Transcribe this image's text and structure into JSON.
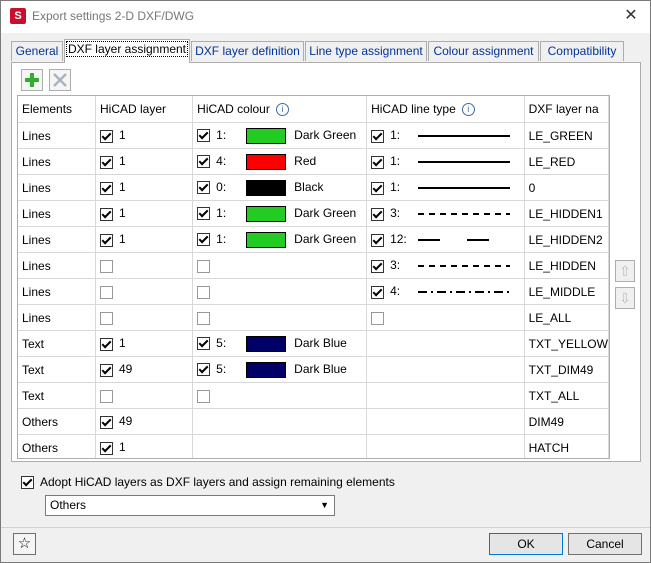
{
  "window": {
    "title": "Export settings 2-D DXF/DWG",
    "app_icon": "S",
    "close_glyph": "✕"
  },
  "tabs": [
    {
      "label": "General"
    },
    {
      "label": "DXF layer assignment",
      "active": true
    },
    {
      "label": "DXF layer definition"
    },
    {
      "label": "Line type assignment"
    },
    {
      "label": "Colour assignment"
    },
    {
      "label": "Compatibility"
    }
  ],
  "toolbar": {
    "add_icon": "add-icon",
    "delete_icon": "delete-icon"
  },
  "table": {
    "headers": [
      "Elements",
      "HiCAD layer",
      "HiCAD colour",
      "HiCAD line type",
      "DXF layer na"
    ],
    "rows": [
      {
        "element": "Lines",
        "layer_checked": true,
        "layer": "1",
        "colour_checked": true,
        "colour_num": "1:",
        "swatch": "#22cc22",
        "colour_name": "Dark Green",
        "lt_checked": true,
        "lt_num": "1:",
        "lt_style": "solid",
        "dxf": "LE_GREEN"
      },
      {
        "element": "Lines",
        "layer_checked": true,
        "layer": "1",
        "colour_checked": true,
        "colour_num": "4:",
        "swatch": "#ff0000",
        "colour_name": "Red",
        "lt_checked": true,
        "lt_num": "1:",
        "lt_style": "solid",
        "dxf": "LE_RED"
      },
      {
        "element": "Lines",
        "layer_checked": true,
        "layer": "1",
        "colour_checked": true,
        "colour_num": "0:",
        "swatch": "#000000",
        "colour_name": "Black",
        "lt_checked": true,
        "lt_num": "1:",
        "lt_style": "solid",
        "dxf": "0"
      },
      {
        "element": "Lines",
        "layer_checked": true,
        "layer": "1",
        "colour_checked": true,
        "colour_num": "1:",
        "swatch": "#22cc22",
        "colour_name": "Dark Green",
        "lt_checked": true,
        "lt_num": "3:",
        "lt_style": "dashed",
        "dxf": "LE_HIDDEN1"
      },
      {
        "element": "Lines",
        "layer_checked": true,
        "layer": "1",
        "colour_checked": true,
        "colour_num": "1:",
        "swatch": "#22cc22",
        "colour_name": "Dark Green",
        "lt_checked": true,
        "lt_num": "12:",
        "lt_style": "longdash",
        "dxf": "LE_HIDDEN2"
      },
      {
        "element": "Lines",
        "layer_checked": false,
        "layer": "",
        "colour_checked": false,
        "colour_num": "",
        "swatch": "",
        "colour_name": "",
        "lt_checked": true,
        "lt_num": "3:",
        "lt_style": "dashed",
        "dxf": "LE_HIDDEN"
      },
      {
        "element": "Lines",
        "layer_checked": false,
        "layer": "",
        "colour_checked": false,
        "colour_num": "",
        "swatch": "",
        "colour_name": "",
        "lt_checked": true,
        "lt_num": "4:",
        "lt_style": "dashdot",
        "dxf": "LE_MIDDLE"
      },
      {
        "element": "Lines",
        "layer_checked": false,
        "layer": "",
        "colour_checked": false,
        "colour_num": "",
        "swatch": "",
        "colour_name": "",
        "lt_checked": false,
        "lt_num": "",
        "lt_style": "",
        "dxf": "LE_ALL"
      },
      {
        "element": "Text",
        "layer_checked": true,
        "layer": "1",
        "colour_checked": true,
        "colour_num": "5:",
        "swatch": "#000066",
        "colour_name": "Dark Blue",
        "lt_checked": null,
        "lt_num": "",
        "lt_style": "",
        "dxf": "TXT_YELLOW"
      },
      {
        "element": "Text",
        "layer_checked": true,
        "layer": "49",
        "colour_checked": true,
        "colour_num": "5:",
        "swatch": "#000066",
        "colour_name": "Dark Blue",
        "lt_checked": null,
        "lt_num": "",
        "lt_style": "",
        "dxf": "TXT_DIM49"
      },
      {
        "element": "Text",
        "layer_checked": false,
        "layer": "",
        "colour_checked": false,
        "colour_num": "",
        "swatch": "",
        "colour_name": "",
        "lt_checked": null,
        "lt_num": "",
        "lt_style": "",
        "dxf": "TXT_ALL"
      },
      {
        "element": "Others",
        "layer_checked": true,
        "layer": "49",
        "colour_checked": null,
        "colour_num": "",
        "swatch": "",
        "colour_name": "",
        "lt_checked": null,
        "lt_num": "",
        "lt_style": "",
        "dxf": "DIM49"
      },
      {
        "element": "Others",
        "layer_checked": true,
        "layer": "1",
        "colour_checked": null,
        "colour_num": "",
        "swatch": "",
        "colour_name": "",
        "lt_checked": null,
        "lt_num": "",
        "lt_style": "",
        "dxf": "HATCH"
      }
    ]
  },
  "side_buttons": {
    "up_glyph": "⇧",
    "down_glyph": "⇩"
  },
  "adopt": {
    "checked": true,
    "label": "Adopt HiCAD layers as DXF layers and assign remaining elements"
  },
  "select": {
    "value": "Others",
    "chevron": "▼"
  },
  "footer": {
    "favorites_glyph": "☆",
    "ok": "OK",
    "cancel": "Cancel"
  }
}
